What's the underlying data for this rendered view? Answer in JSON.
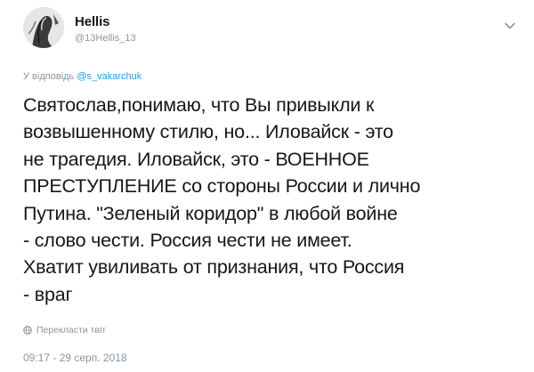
{
  "author": {
    "display_name": "Hellis",
    "handle": "@13Hellis_13",
    "avatar_icon": "avatar-photo"
  },
  "reply": {
    "prefix": "У відповідь",
    "mention": "@s_vakarchuk"
  },
  "tweet": {
    "text": "Святослав,понимаю, что Вы привыкли к\nвозвышенному стилю, но... Иловайск - это\nне трагедия. Иловайск, это - ВОЕННОЕ\nПРЕСТУПЛЕНИЕ со стороны России и лично\nПутина. \"Зеленый коридор\" в любой войне\n- слово чести. Россия чести не имеет.\nХватит увиливать от признания, что Россия\n- враг"
  },
  "actions": {
    "translate_label": "Перекласти твіт",
    "translate_icon": "globe-icon",
    "menu_icon": "chevron-down-icon"
  },
  "meta": {
    "timestamp": "09:17 - 29 серп. 2018"
  },
  "colors": {
    "text": "#14171a",
    "muted": "#8a959f",
    "link": "#1da1f2"
  }
}
